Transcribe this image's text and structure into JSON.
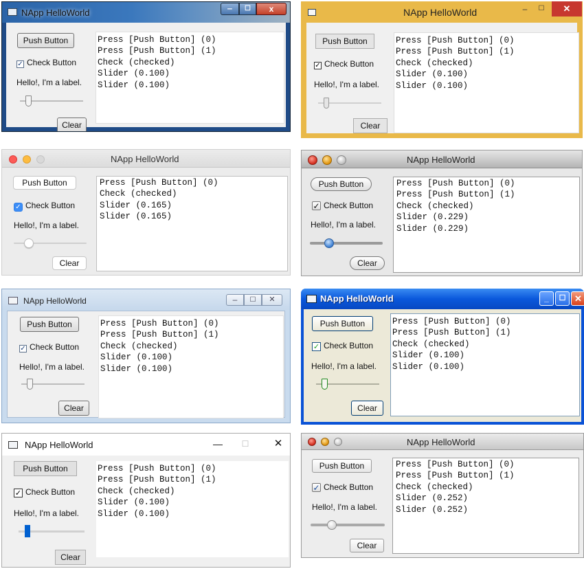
{
  "windows": [
    {
      "platform": "Windows 7",
      "title": "NApp HelloWorld",
      "push_button": "Push Button",
      "check_button": "Check Button",
      "check_state": "checked",
      "label": "Hello!, I'm a label.",
      "slider_value": 0.1,
      "clear_button": "Clear",
      "lines": [
        "Press [Push Button] (0)",
        "Press [Push Button] (1)",
        "Check (checked)",
        "Slider (0.100)",
        "Slider (0.100)"
      ]
    },
    {
      "platform": "Windows 8",
      "title": "NApp HelloWorld",
      "push_button": "Push Button",
      "check_button": "Check Button",
      "check_state": "checked",
      "label": "Hello!, I'm a label.",
      "slider_value": 0.1,
      "clear_button": "Clear",
      "lines": [
        "Press [Push Button] (0)",
        "Press [Push Button] (1)",
        "Check (checked)",
        "Slider (0.100)",
        "Slider (0.100)"
      ]
    },
    {
      "platform": "macOS Yosemite",
      "title": "NApp HelloWorld",
      "push_button": "Push Button",
      "check_button": "Check Button",
      "check_state": "checked",
      "label": "Hello!, I'm a label.",
      "slider_value": 0.165,
      "clear_button": "Clear",
      "lines": [
        "Press [Push Button] (0)",
        "Check (checked)",
        "Slider (0.165)",
        "Slider (0.165)"
      ]
    },
    {
      "platform": "macOS Snow Leopard",
      "title": "NApp HelloWorld",
      "push_button": "Push Button",
      "check_button": "Check Button",
      "check_state": "checked",
      "label": "Hello!, I'm a label.",
      "slider_value": 0.229,
      "clear_button": "Clear",
      "lines": [
        "Press [Push Button] (0)",
        "Press [Push Button] (1)",
        "Check (checked)",
        "Slider (0.229)",
        "Slider (0.229)"
      ]
    },
    {
      "platform": "Windows Vista",
      "title": "NApp HelloWorld",
      "push_button": "Push Button",
      "check_button": "Check Button",
      "check_state": "checked",
      "label": "Hello!, I'm a label.",
      "slider_value": 0.1,
      "clear_button": "Clear",
      "lines": [
        "Press [Push Button] (0)",
        "Press [Push Button] (1)",
        "Check (checked)",
        "Slider (0.100)",
        "Slider (0.100)"
      ]
    },
    {
      "platform": "Windows XP",
      "title": "NApp HelloWorld",
      "push_button": "Push Button",
      "check_button": "Check Button",
      "check_state": "checked",
      "label": "Hello!, I'm a label.",
      "slider_value": 0.1,
      "clear_button": "Clear",
      "lines": [
        "Press [Push Button] (0)",
        "Press [Push Button] (1)",
        "Check (checked)",
        "Slider (0.100)",
        "Slider (0.100)"
      ]
    },
    {
      "platform": "Windows 10",
      "title": "NApp HelloWorld",
      "push_button": "Push Button",
      "check_button": "Check Button",
      "check_state": "checked",
      "label": "Hello!, I'm a label.",
      "slider_value": 0.1,
      "clear_button": "Clear",
      "lines": [
        "Press [Push Button] (0)",
        "Press [Push Button] (1)",
        "Check (checked)",
        "Slider (0.100)",
        "Slider (0.100)"
      ]
    },
    {
      "platform": "macOS Mountain Lion",
      "title": "NApp HelloWorld",
      "push_button": "Push Button",
      "check_button": "Check Button",
      "check_state": "checked",
      "label": "Hello!, I'm a label.",
      "slider_value": 0.252,
      "clear_button": "Clear",
      "lines": [
        "Press [Push Button] (0)",
        "Press [Push Button] (1)",
        "Check (checked)",
        "Slider (0.252)",
        "Slider (0.252)"
      ]
    }
  ]
}
